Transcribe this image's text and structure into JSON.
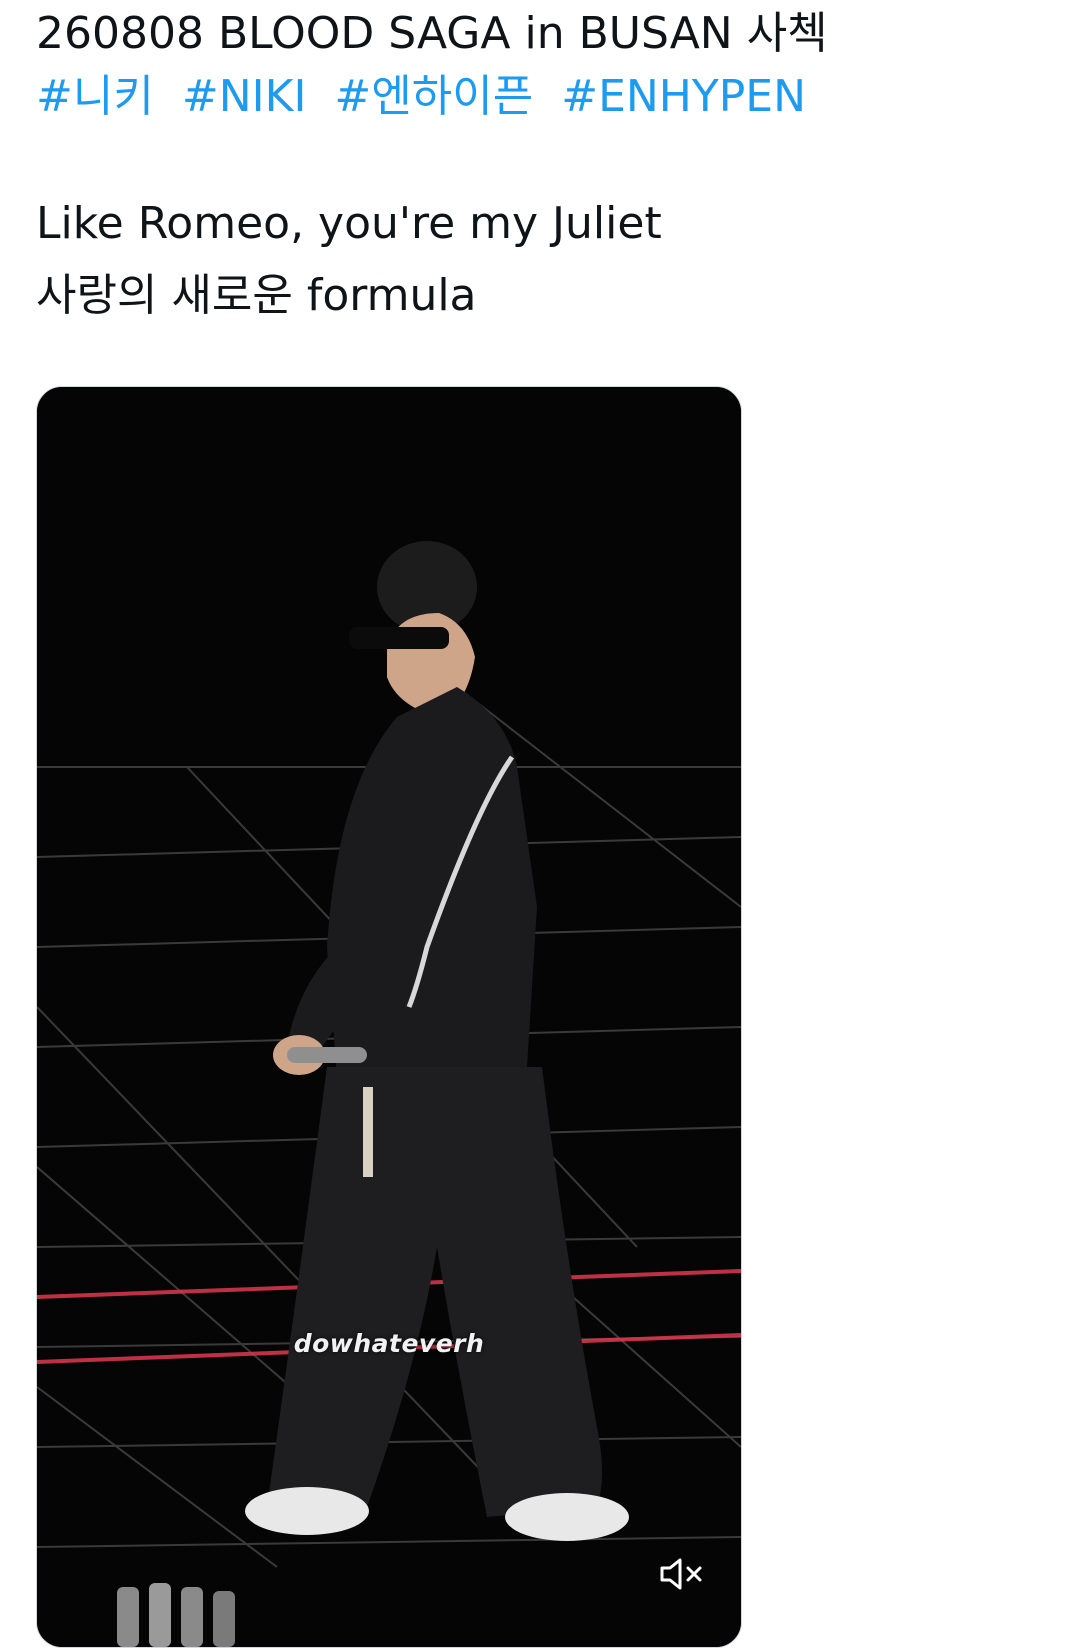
{
  "tweet": {
    "title": "260808 BLOOD SAGA in BUSAN 사첵",
    "hashtags": [
      "#니키",
      "#NIKI",
      "#엔하이픈",
      "#ENHYPEN"
    ],
    "lyrics": [
      "Like Romeo, you're my Juliet",
      "사랑의 새로운 formula"
    ]
  },
  "media": {
    "watermark": "dowhateverh",
    "mute_icon": "speaker-muted-icon"
  },
  "colors": {
    "hashtag": "#1d9bf0",
    "text": "#0f1419",
    "video_bg": "#050505",
    "stage_light": "#e0384f"
  }
}
